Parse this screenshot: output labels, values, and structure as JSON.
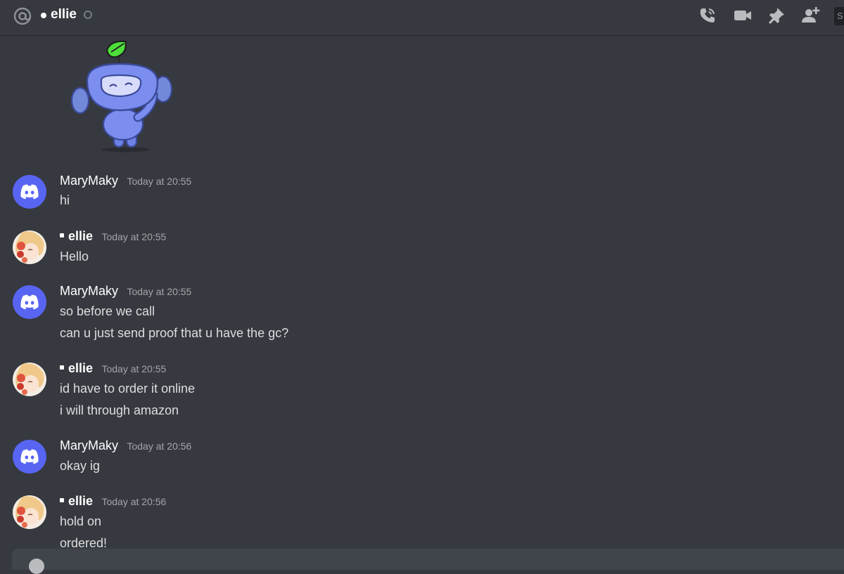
{
  "header": {
    "channel_name": "ellie",
    "search_label": "S"
  },
  "messages": [
    {
      "author": "MaryMaky",
      "timestamp": "Today at 20:55",
      "lines": [
        "hi"
      ]
    },
    {
      "author": "ellie",
      "timestamp": "Today at 20:55",
      "lines": [
        "Hello"
      ]
    },
    {
      "author": "MaryMaky",
      "timestamp": "Today at 20:55",
      "lines": [
        "so before we call",
        "can u just send proof that u have the gc?"
      ]
    },
    {
      "author": "ellie",
      "timestamp": "Today at 20:55",
      "lines": [
        "id have to order it online",
        "i will through amazon"
      ]
    },
    {
      "author": "MaryMaky",
      "timestamp": "Today at 20:56",
      "lines": [
        "okay ig"
      ]
    },
    {
      "author": "ellie",
      "timestamp": "Today at 20:56",
      "lines": [
        "hold on",
        "ordered!"
      ]
    }
  ],
  "icons": [
    "at-icon",
    "call-icon",
    "video-icon",
    "pin-icon",
    "add-friend-icon"
  ],
  "colors": {
    "background": "#36393f",
    "blurple": "#5865f2",
    "text": "#dcddde",
    "timestamp": "#a3a6aa"
  }
}
